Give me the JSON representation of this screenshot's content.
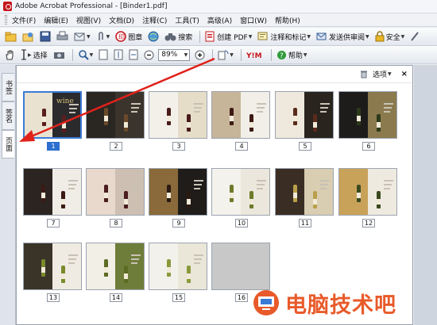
{
  "window": {
    "title": "Adobe Acrobat Professional - [Binder1.pdf]"
  },
  "menu": [
    "文件(F)",
    "编辑(E)",
    "视图(V)",
    "文档(D)",
    "注释(C)",
    "工具(T)",
    "高级(A)",
    "窗口(W)",
    "帮助(H)"
  ],
  "toolbar1": {
    "stamp_label": "图章",
    "search_label": "搜索",
    "create_pdf_label": "创建 PDF",
    "comment_label": "注释和标记",
    "review_label": "发送供审阅",
    "security_label": "安全"
  },
  "toolbar2": {
    "select_label": "选择",
    "zoom_value": "89%",
    "help_label": "帮助"
  },
  "nav_tabs": [
    "书签",
    "签名",
    "页面"
  ],
  "panel": {
    "options_label": "选项",
    "close_symbol": "×"
  },
  "pages": [
    {
      "label": "1",
      "selected": true,
      "left": "#e9e2d0",
      "right": "#2b2b2e",
      "bottle": "#5a1e1e",
      "caption": "wine"
    },
    {
      "label": "2",
      "selected": false,
      "left": "#2a2622",
      "right": "#3a342c",
      "bottle": "#6b4a2a"
    },
    {
      "label": "3",
      "selected": false,
      "left": "#f3f0ea",
      "right": "#e6ddc8",
      "bottle": "#4a1b1b"
    },
    {
      "label": "4",
      "selected": false,
      "left": "#c7b59a",
      "right": "#f2efe8",
      "bottle": "#3d1a14"
    },
    {
      "label": "5",
      "selected": false,
      "left": "#efe9dd",
      "right": "#2a241f",
      "bottle": "#5a2b1b"
    },
    {
      "label": "6",
      "selected": false,
      "left": "#1e1c1b",
      "right": "#8a7a4e",
      "bottle": "#2d3a1a"
    },
    {
      "label": "7",
      "selected": false,
      "left": "#2b2420",
      "right": "#f0ede6",
      "bottle": "#3a1a16"
    },
    {
      "label": "8",
      "selected": false,
      "left": "#e8d9cc",
      "right": "#cdbfb2",
      "bottle": "#4b1c20"
    },
    {
      "label": "9",
      "selected": false,
      "left": "#8a6a3a",
      "right": "#1f1c1a",
      "bottle": "#2a1a12"
    },
    {
      "label": "10",
      "selected": false,
      "left": "#f4f2ec",
      "right": "#ebe7dc",
      "bottle": "#6e7a2a"
    },
    {
      "label": "11",
      "selected": false,
      "left": "#3a2e24",
      "right": "#d9cdb2",
      "bottle": "#b9a04a"
    },
    {
      "label": "12",
      "selected": false,
      "left": "#c9a25a",
      "right": "#eeeae0",
      "bottle": "#3b4a1e"
    },
    {
      "label": "13",
      "selected": false,
      "left": "#3a3328",
      "right": "#efebe2",
      "bottle": "#7a8a2c"
    },
    {
      "label": "14",
      "selected": false,
      "left": "#f2efe6",
      "right": "#6f7d3a",
      "bottle": "#5c6a22"
    },
    {
      "label": "15",
      "selected": false,
      "left": "#f3f1eb",
      "right": "#eae6d8",
      "bottle": "#8a9a3a"
    },
    {
      "label": "16",
      "selected": false,
      "left": "#c8c8c8",
      "right": "#c8c8c8",
      "blank": true
    }
  ],
  "watermark": {
    "text": "电脑技术吧"
  }
}
